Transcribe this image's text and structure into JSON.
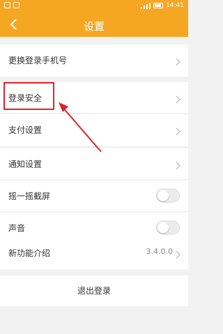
{
  "status_bar": {
    "time": "14:41"
  },
  "header": {
    "title": "设置"
  },
  "groups": {
    "account": {
      "change_phone": "更换登录手机号"
    },
    "security": {
      "login_security": "登录安全",
      "payment_settings": "支付设置"
    },
    "notifications": {
      "notification_settings": "通知设置",
      "shake_screenshot": "摇一摇截屏",
      "sound": "声音"
    },
    "about": {
      "new_features": "新功能介绍",
      "version": "3.4.0.0"
    }
  },
  "toggles": {
    "shake_screenshot": false,
    "sound": false
  },
  "logout": {
    "label": "退出登录"
  },
  "colors": {
    "accent": "#f5a623",
    "annotation": "#d9252a"
  }
}
